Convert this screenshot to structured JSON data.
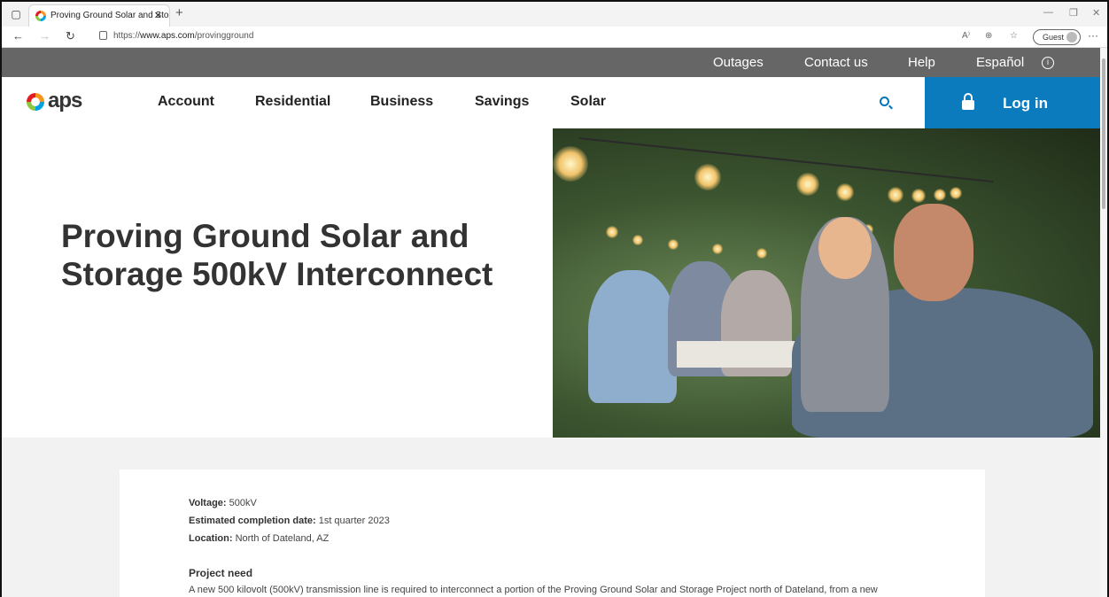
{
  "browser": {
    "tab_title": "Proving Ground Solar and Storag",
    "url_prefix": "https://",
    "url_host": "www.aps.com",
    "url_path": "/provingground",
    "guest_label": "Guest"
  },
  "utility": {
    "outages": "Outages",
    "contact": "Contact us",
    "help": "Help",
    "espanol": "Español"
  },
  "logo_text": "aps",
  "nav": {
    "account": "Account",
    "residential": "Residential",
    "business": "Business",
    "savings": "Savings",
    "solar": "Solar",
    "login": "Log in"
  },
  "hero": {
    "title": "Proving Ground Solar and Storage 500kV Interconnect"
  },
  "details": {
    "voltage_label": "Voltage:",
    "voltage_value": "500kV",
    "completion_label": "Estimated completion date:",
    "completion_value": "1st quarter 2023",
    "location_label": "Location:",
    "location_value": "North of Dateland, AZ",
    "project_need_heading": "Project need",
    "project_need_text": "A new 500 kilovolt (500kV) transmission line is required to interconnect a portion of the Proving Ground Solar and Storage Project north of Dateland, from a new"
  },
  "colors": {
    "utility_bar": "#666666",
    "login_bg": "#0c7bbd",
    "accent": "#0075bc"
  },
  "icons": [
    "tab-actions-icon",
    "favicon",
    "close-icon",
    "new-tab-icon",
    "back-icon",
    "forward-icon",
    "refresh-icon",
    "lock-icon",
    "read-aloud-icon",
    "zoom-icon",
    "favorites-icon",
    "more-icon",
    "info-icon",
    "search-icon",
    "padlock-icon"
  ]
}
